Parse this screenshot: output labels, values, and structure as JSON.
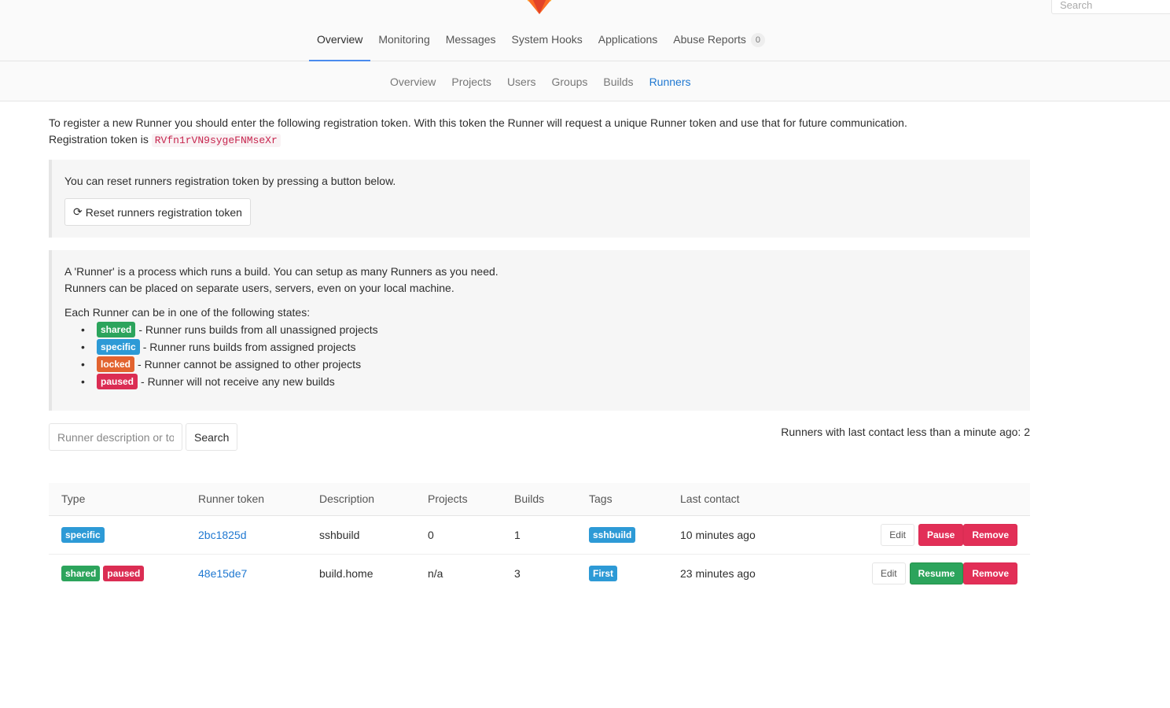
{
  "header": {
    "search_placeholder": "Search",
    "tabs": [
      {
        "label": "Overview"
      },
      {
        "label": "Monitoring"
      },
      {
        "label": "Messages"
      },
      {
        "label": "System Hooks"
      },
      {
        "label": "Applications"
      },
      {
        "label": "Abuse Reports",
        "count": "0"
      }
    ]
  },
  "subnav": {
    "items": [
      {
        "label": "Overview"
      },
      {
        "label": "Projects"
      },
      {
        "label": "Users"
      },
      {
        "label": "Groups"
      },
      {
        "label": "Builds"
      },
      {
        "label": "Runners"
      }
    ]
  },
  "intro": {
    "line1": "To register a new Runner you should enter the following registration token. With this token the Runner will request a unique Runner token and use that for future communication.",
    "token_label": "Registration token is",
    "token": "RVfn1rVN9sygeFNMseXr"
  },
  "reset_well": {
    "text": "You can reset runners registration token by pressing a button below.",
    "button": "Reset runners registration token"
  },
  "info_well": {
    "line1": "A 'Runner' is a process which runs a build. You can setup as many Runners as you need.",
    "line2": "Runners can be placed on separate users, servers, even on your local machine.",
    "states_title": "Each Runner can be in one of the following states:",
    "states": [
      {
        "label": "shared",
        "text": "- Runner runs builds from all unassigned projects"
      },
      {
        "label": "specific",
        "text": "- Runner runs builds from assigned projects"
      },
      {
        "label": "locked",
        "text": "- Runner cannot be assigned to other projects"
      },
      {
        "label": "paused",
        "text": "- Runner will not receive any new builds"
      }
    ]
  },
  "filter": {
    "placeholder": "Runner description or token",
    "button": "Search",
    "online": "Runners with last contact less than a minute ago: 2"
  },
  "table": {
    "headers": [
      "Type",
      "Runner token",
      "Description",
      "Projects",
      "Builds",
      "Tags",
      "Last contact"
    ],
    "rows": [
      {
        "types": [
          "specific"
        ],
        "token": "2bc1825d",
        "description": "sshbuild",
        "projects": "0",
        "builds": "1",
        "tag": "sshbuild",
        "last_contact": "10 minutes ago",
        "toggle": "Pause",
        "edit": "Edit",
        "remove": "Remove"
      },
      {
        "types": [
          "shared",
          "paused"
        ],
        "token": "48e15de7",
        "description": "build.home",
        "projects": "n/a",
        "builds": "3",
        "tag": "First",
        "last_contact": "23 minutes ago",
        "toggle": "Resume",
        "edit": "Edit",
        "remove": "Remove"
      }
    ]
  }
}
